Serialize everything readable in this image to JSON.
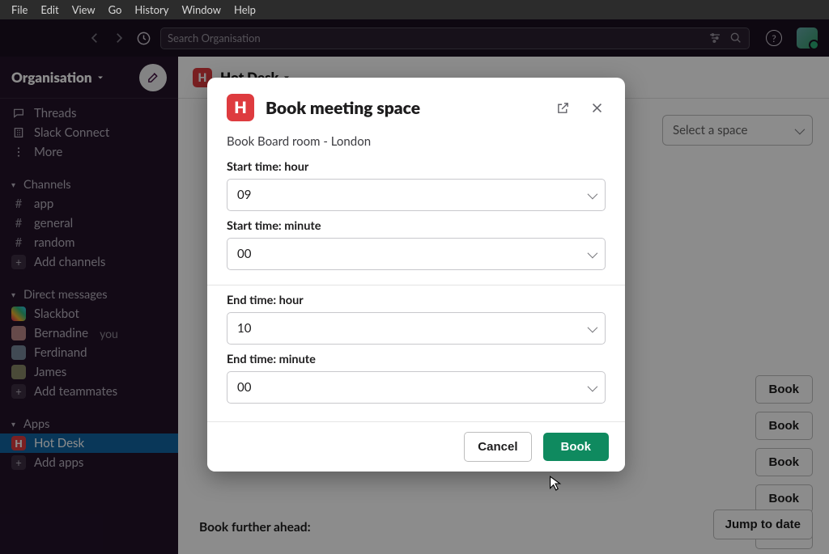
{
  "os_menu": [
    "File",
    "Edit",
    "View",
    "Go",
    "History",
    "Window",
    "Help"
  ],
  "search": {
    "placeholder": "Search Organisation"
  },
  "workspace": {
    "name": "Organisation"
  },
  "sidebar": {
    "threads": "Threads",
    "slack_connect": "Slack Connect",
    "more": "More",
    "channels_label": "Channels",
    "channels": [
      "app",
      "general",
      "random"
    ],
    "add_channels": "Add channels",
    "dm_label": "Direct messages",
    "dms": [
      {
        "name": "Slackbot"
      },
      {
        "name": "Bernadine",
        "you": "you"
      },
      {
        "name": "Ferdinand"
      },
      {
        "name": "James"
      }
    ],
    "add_teammates": "Add teammates",
    "apps_label": "Apps",
    "hot_desk": "Hot Desk",
    "add_apps": "Add apps"
  },
  "channel_header": {
    "title": "Hot Desk"
  },
  "main": {
    "select_space": "Select a space",
    "book_label": "Book",
    "further_ahead": "Book further ahead:",
    "jump_label": "Jump to date"
  },
  "modal": {
    "title": "Book meeting space",
    "subtitle": "Book Board room - London",
    "fields": {
      "start_hour_label": "Start time: hour",
      "start_hour_value": "09",
      "start_min_label": "Start time: minute",
      "start_min_value": "00",
      "end_hour_label": "End time: hour",
      "end_hour_value": "10",
      "end_min_label": "End time: minute",
      "end_min_value": "00"
    },
    "cancel": "Cancel",
    "book": "Book"
  }
}
